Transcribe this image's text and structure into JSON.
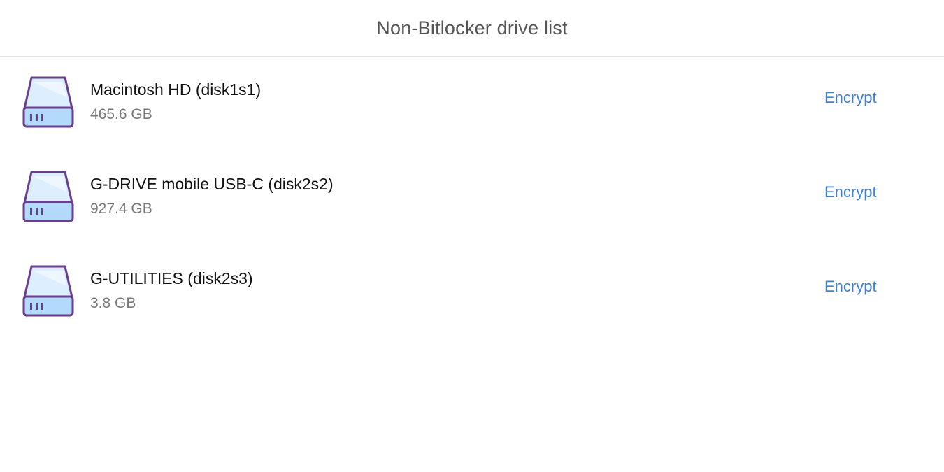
{
  "header": {
    "title": "Non-Bitlocker drive list"
  },
  "drives": [
    {
      "name": "Macintosh HD (disk1s1)",
      "size": "465.6 GB",
      "action": "Encrypt",
      "icon": "hard-drive-icon"
    },
    {
      "name": "G-DRIVE mobile USB-C (disk2s2)",
      "size": "927.4 GB",
      "action": "Encrypt",
      "icon": "hard-drive-icon"
    },
    {
      "name": "G-UTILITIES (disk2s3)",
      "size": "3.8 GB",
      "action": "Encrypt",
      "icon": "hard-drive-icon"
    }
  ],
  "colors": {
    "accent": "#3e7fd6",
    "icon_stroke": "#6a3f8f",
    "icon_fill": "#ddeeff",
    "icon_base": "#b3d9fb"
  }
}
